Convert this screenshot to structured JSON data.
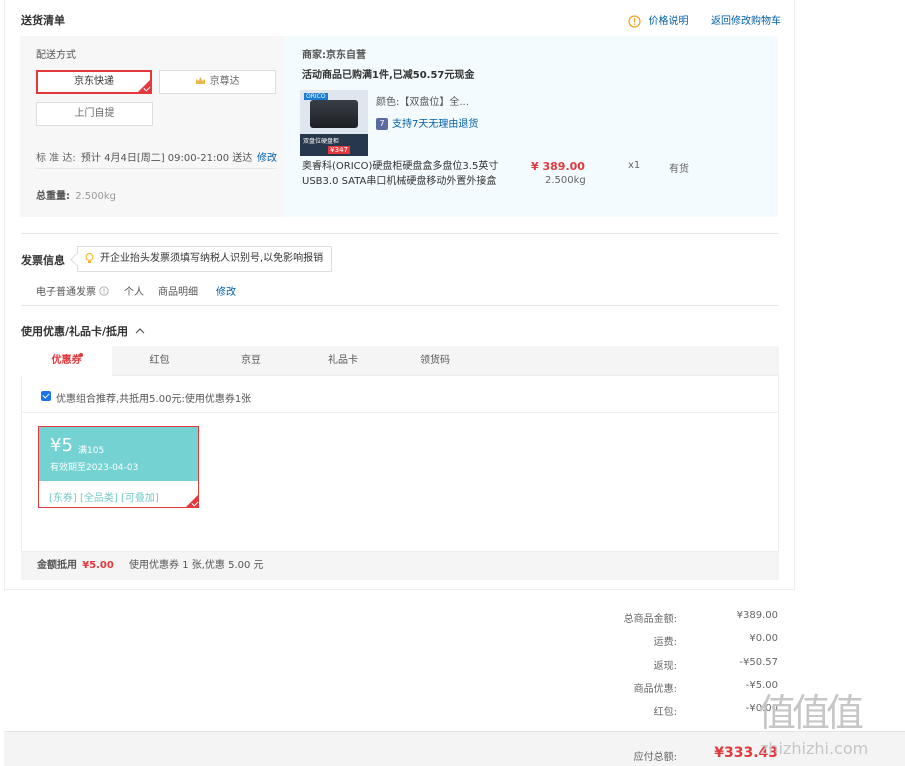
{
  "delivery": {
    "title": "送货清单",
    "price_info": "价格说明",
    "back_cart": "返回修改购物车",
    "method_label": "配送方式",
    "options": [
      "京东快递",
      "京尊达",
      "上门自提"
    ],
    "schedule_label": "标 准 达:",
    "schedule_value": "预计 4月4日[周二] 09:00-21:00 送达",
    "schedule_edit": "修改",
    "weight_label": "总重量:",
    "weight_value": "2.500kg"
  },
  "order": {
    "merchant": "商家:京东自营",
    "promo": "活动商品已购满1件,已减50.57元现金",
    "color": "颜色:【双盘位】全...",
    "return_badge": "7",
    "return_policy": "支持7天无理由退货",
    "product_name_1": "奥睿科(ORICO)硬盘柜硬盘盒多盘位3.5英寸",
    "product_name_2": "USB3.0 SATA串口机械硬盘移动外置外接盒",
    "price": "¥ 389.00",
    "item_weight": "2.500kg",
    "qty": "x1",
    "stock": "有货",
    "img_logo": "ORICO",
    "img_banner": "双盘位硬盘柜",
    "img_tag": "¥347"
  },
  "invoice": {
    "title": "发票信息",
    "tip": "开企业抬头发票须填写纳税人识别号,以免影响报销",
    "type": "电子普通发票",
    "person": "个人",
    "detail": "商品明细",
    "edit": "修改"
  },
  "coupon": {
    "title": "使用优惠/礼品卡/抵用",
    "tabs": [
      "优惠券",
      "红包",
      "京豆",
      "礼品卡",
      "领货码"
    ],
    "recommend": "优惠组合推荐,共抵用5.00元:使用优惠券1张",
    "amount": "¥5",
    "condition": "满105",
    "expire": "有效期至2023-04-03",
    "tags": "[东券] [全品类] [可叠加]",
    "summary_label": "金额抵用",
    "summary_amount": "¥5.00",
    "summary_detail": "使用优惠券 1 张,优惠 5.00 元"
  },
  "totals": {
    "rows": [
      {
        "label": "总商品金额:",
        "value": "¥389.00"
      },
      {
        "label": "运费:",
        "value": "¥0.00"
      },
      {
        "label": "返现:",
        "value": "-¥50.57"
      },
      {
        "label": "商品优惠:",
        "value": "-¥5.00"
      },
      {
        "label": "红包:",
        "value": "-¥0.00"
      }
    ],
    "pay_label": "应付总额:",
    "pay_value": "¥333.43"
  },
  "watermark": {
    "logo": "值值值",
    "domain": "zhizhizhi.com"
  },
  "colors": {
    "accent": "#e4393c",
    "link": "#005ea7",
    "coupon": "#74d2d2"
  }
}
